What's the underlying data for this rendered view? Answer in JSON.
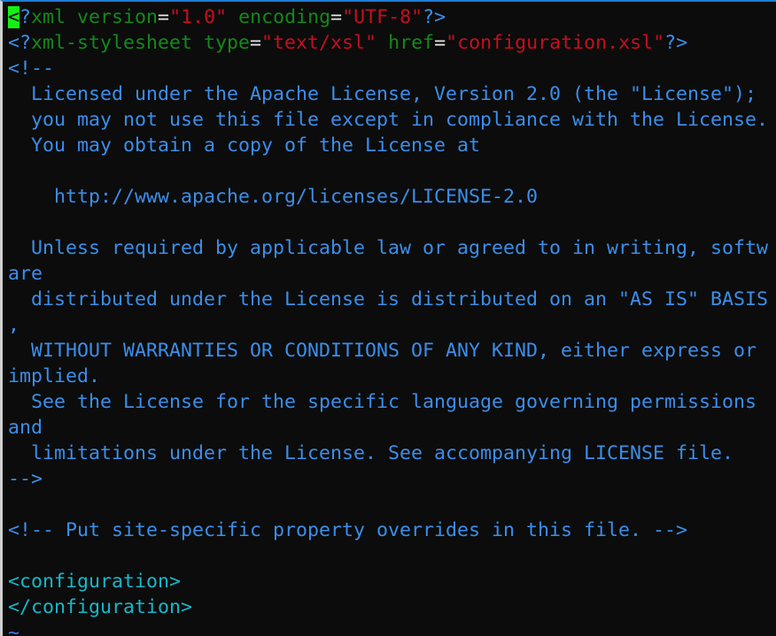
{
  "editor": {
    "cursor_color": "#14f014",
    "lines": [
      [
        {
          "t": "<",
          "c": "cursor"
        },
        {
          "t": "?",
          "c": "c-punct"
        },
        {
          "t": "xml version",
          "c": "c-tagname"
        },
        {
          "t": "=",
          "c": "c-eq"
        },
        {
          "t": "\"1.0\"",
          "c": "c-string"
        },
        {
          "t": " encoding",
          "c": "c-tagname"
        },
        {
          "t": "=",
          "c": "c-eq"
        },
        {
          "t": "\"UTF-8\"",
          "c": "c-string"
        },
        {
          "t": "?>",
          "c": "c-punct"
        }
      ],
      [
        {
          "t": "<?",
          "c": "c-punct"
        },
        {
          "t": "xml-stylesheet type",
          "c": "c-tagname"
        },
        {
          "t": "=",
          "c": "c-eq"
        },
        {
          "t": "\"text/xsl\"",
          "c": "c-string"
        },
        {
          "t": " href",
          "c": "c-tagname"
        },
        {
          "t": "=",
          "c": "c-eq"
        },
        {
          "t": "\"configuration.xsl\"",
          "c": "c-string"
        },
        {
          "t": "?>",
          "c": "c-punct"
        }
      ],
      [
        {
          "t": "<!--",
          "c": "c-comment"
        }
      ],
      [
        {
          "t": "  Licensed under the Apache License, Version 2.0 (the \"License\");",
          "c": "c-comment"
        }
      ],
      [
        {
          "t": "  you may not use this file except in compliance with the License.",
          "c": "c-comment"
        }
      ],
      [
        {
          "t": "  You may obtain a copy of the License at",
          "c": "c-comment"
        }
      ],
      [],
      [
        {
          "t": "    http://www.apache.org/licenses/LICENSE-2.0",
          "c": "c-comment"
        }
      ],
      [],
      [
        {
          "t": "  Unless required by applicable law or agreed to in writing, softw",
          "c": "c-comment"
        }
      ],
      [
        {
          "t": "are",
          "c": "c-comment"
        }
      ],
      [
        {
          "t": "  distributed under the License is distributed on an \"AS IS\" BASIS",
          "c": "c-comment"
        }
      ],
      [
        {
          "t": ",",
          "c": "c-comment"
        }
      ],
      [
        {
          "t": "  WITHOUT WARRANTIES OR CONDITIONS OF ANY KIND, either express or",
          "c": "c-comment"
        }
      ],
      [
        {
          "t": "implied.",
          "c": "c-comment"
        }
      ],
      [
        {
          "t": "  See the License for the specific language governing permissions",
          "c": "c-comment"
        }
      ],
      [
        {
          "t": "and",
          "c": "c-comment"
        }
      ],
      [
        {
          "t": "  limitations under the License. See accompanying LICENSE file.",
          "c": "c-comment"
        }
      ],
      [
        {
          "t": "-->",
          "c": "c-comment"
        }
      ],
      [],
      [
        {
          "t": "<!-- Put site-specific property overrides in this file. -->",
          "c": "c-comment"
        }
      ],
      [],
      [
        {
          "t": "<configuration>",
          "c": "c-tag"
        }
      ],
      [
        {
          "t": "</configuration>",
          "c": "c-tag"
        }
      ],
      [
        {
          "t": "~",
          "c": "c-tilde"
        }
      ]
    ]
  }
}
